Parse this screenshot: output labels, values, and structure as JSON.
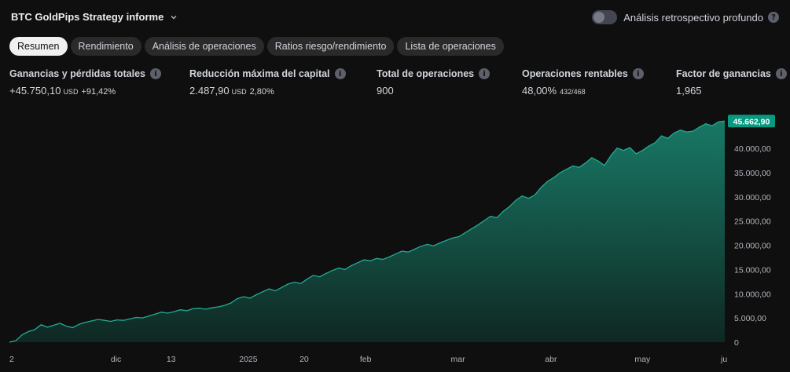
{
  "header": {
    "title": "BTC GoldPips Strategy informe",
    "toggle_label": "Análisis retrospectivo profundo"
  },
  "tabs": [
    {
      "label": "Resumen",
      "active": true
    },
    {
      "label": "Rendimiento",
      "active": false
    },
    {
      "label": "Análisis de operaciones",
      "active": false
    },
    {
      "label": "Ratios riesgo/rendimiento",
      "active": false
    },
    {
      "label": "Lista de operaciones",
      "active": false
    }
  ],
  "stats": {
    "net_profit": {
      "label": "Ganancias y pérdidas totales",
      "value": "+45.750,10",
      "unit": "USD",
      "sub": "+91,42%"
    },
    "max_drawdown": {
      "label": "Reducción máxima del capital",
      "value": "2.487,90",
      "unit": "USD",
      "sub": "2,80%"
    },
    "total_trades": {
      "label": "Total de operaciones",
      "value": "900"
    },
    "profitable": {
      "label": "Operaciones rentables",
      "value": "48,00%",
      "sub": "432/468"
    },
    "profit_factor": {
      "label": "Factor de ganancias",
      "value": "1,965"
    }
  },
  "colors": {
    "accent_green": "#22ab94",
    "line": "#22ab94",
    "background": "#0f0f0f"
  },
  "chart_data": {
    "type": "area",
    "y_ticks": [
      "0",
      "5.000,00",
      "10.000,00",
      "15.000,00",
      "20.000,00",
      "25.000,00",
      "30.000,00",
      "35.000,00",
      "40.000,00"
    ],
    "ylim": [
      0,
      47000
    ],
    "x_ticks": [
      "2",
      "dic",
      "13",
      "2025",
      "20",
      "feb",
      "mar",
      "abr",
      "may",
      "ju"
    ],
    "last_value_label": "45.662,90",
    "series": [
      {
        "values": [
          0,
          300,
          1500,
          2200,
          2600,
          3600,
          3100,
          3500,
          3900,
          3300,
          3000,
          3700,
          4100,
          4400,
          4700,
          4500,
          4300,
          4600,
          4500,
          4800,
          5100,
          5000,
          5400,
          5800,
          6200,
          6000,
          6300,
          6700,
          6500,
          6900,
          7000,
          6800,
          7100,
          7300,
          7600,
          8100,
          9000,
          9400,
          9100,
          9800,
          10400,
          11000,
          10600,
          11300,
          12000,
          12400,
          12100,
          13000,
          13800,
          13500,
          14200,
          14800,
          15300,
          15000,
          15800,
          16400,
          17000,
          16800,
          17300,
          17100,
          17600,
          18200,
          18800,
          18600,
          19200,
          19800,
          20200,
          19900,
          20500,
          21000,
          21500,
          21800,
          22600,
          23400,
          24200,
          25100,
          26000,
          25700,
          27000,
          28000,
          29300,
          30200,
          29700,
          30400,
          32000,
          33200,
          34000,
          35000,
          35700,
          36400,
          36100,
          37000,
          38100,
          37400,
          36500,
          38500,
          40100,
          39600,
          40200,
          38900,
          39600,
          40500,
          41200,
          42600,
          42100,
          43200,
          43800,
          43400,
          43600,
          44400,
          45100,
          44700,
          45500,
          45662.9
        ]
      }
    ]
  }
}
